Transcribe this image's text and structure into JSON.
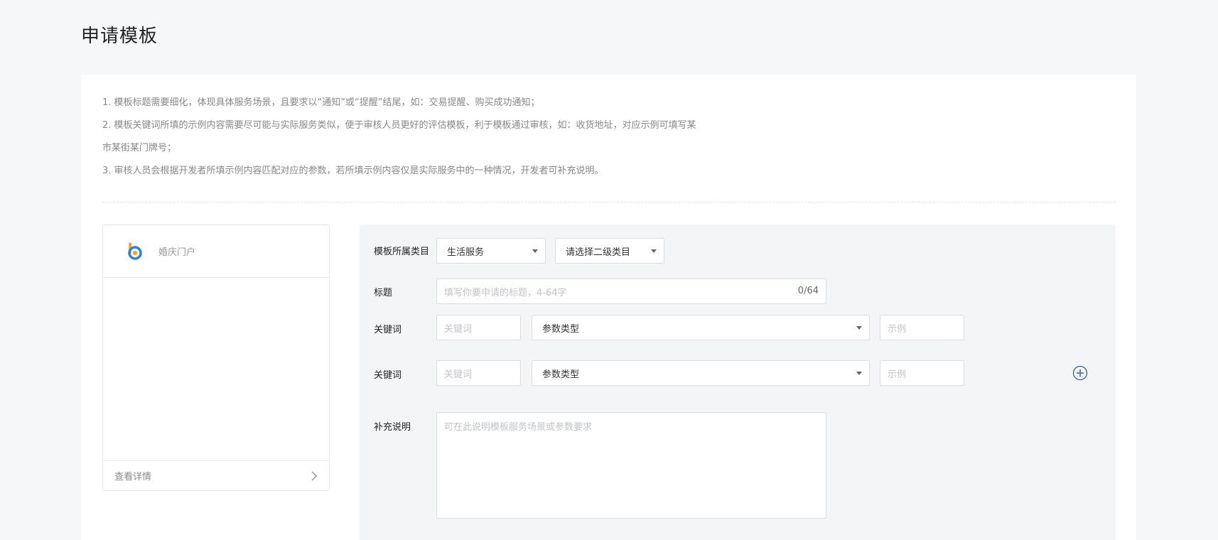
{
  "page": {
    "title": "申请模板"
  },
  "notes": [
    "1. 模板标题需要细化，体现具体服务场景，且要求以“通知”或“提醒”结尾，如：交易提醒、购买成功通知；",
    "2. 模板关键词所填的示例内容需要尽可能与实际服务类似，便于审核人员更好的评估模板，利于模板通过审核，如：收货地址，对应示例可填写某",
    "市某街某门牌号；",
    "3. 审核人员会根据开发者所填示例内容匹配对应的参数，若所填示例内容仅是实际服务中的一种情况，开发者可补充说明。"
  ],
  "preview": {
    "account_name": "婚庆门户",
    "logo_icon": "brand-logo-icon",
    "details_link": "查看详情",
    "details_icon": "chevron-right-icon"
  },
  "form": {
    "category": {
      "label": "模板所属类目",
      "primary": "生活服务",
      "secondary": "请选择二级类目"
    },
    "title": {
      "label": "标题",
      "placeholder": "填写你要申请的标题，4-64字",
      "counter": "0/64"
    },
    "keywords": [
      {
        "label": "关键词",
        "keyword_placeholder": "关键词",
        "type": "参数类型",
        "example_placeholder": "示例"
      },
      {
        "label": "关键词",
        "keyword_placeholder": "关键词",
        "type": "参数类型",
        "example_placeholder": "示例"
      }
    ],
    "add_keyword_icon": "plus-circle-icon",
    "supplement": {
      "label": "补充说明",
      "placeholder": "可在此说明模板服务场景或参数要求"
    }
  },
  "colors": {
    "background": "#f6f7f9",
    "card": "#ffffff",
    "panel": "#f4f5f7",
    "accent": "#3e5d9b",
    "logo_orange": "#f29b2c",
    "logo_blue": "#2f7ed8"
  }
}
